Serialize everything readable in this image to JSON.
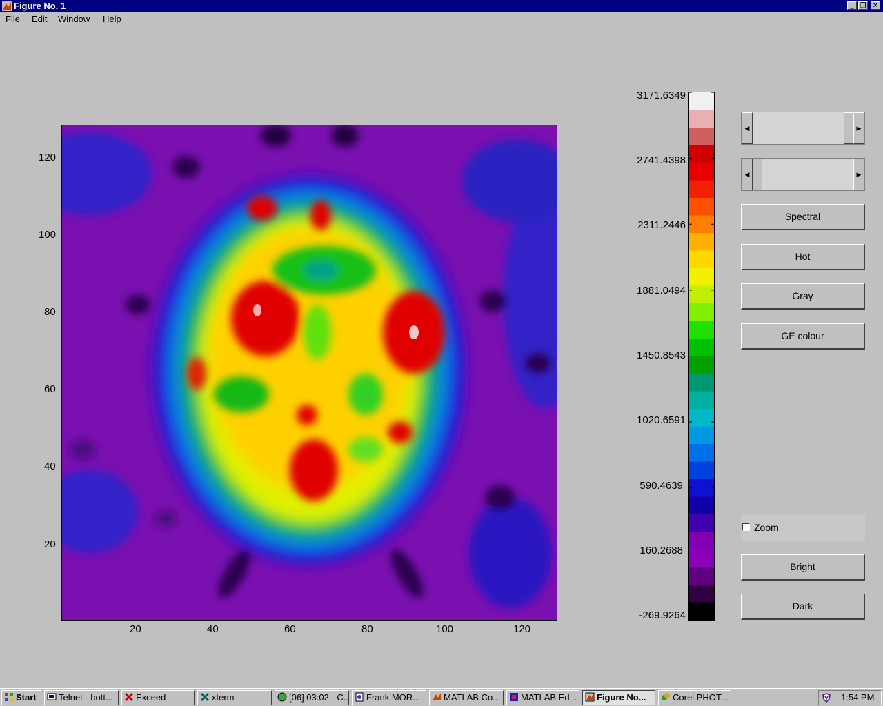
{
  "window": {
    "title": "Figure No. 1"
  },
  "menu": {
    "items": [
      {
        "label": "File"
      },
      {
        "label": "Edit"
      },
      {
        "label": "Window"
      },
      {
        "label": "Help"
      }
    ]
  },
  "image_plot": {
    "x_ticks": [
      "20",
      "40",
      "60",
      "80",
      "100",
      "120"
    ],
    "y_ticks": [
      "120",
      "100",
      "80",
      "60",
      "40",
      "20"
    ]
  },
  "colorbar": {
    "labels": [
      "3171.6349",
      "2741.4398",
      "2311.2446",
      "1881.0494",
      "1450.8543",
      "1020.6591",
      "590.4639",
      "160.2688",
      "-269.9264"
    ]
  },
  "controls": {
    "spectral": "Spectral",
    "hot": "Hot",
    "gray": "Gray",
    "ge_colour": "GE colour",
    "zoom": "Zoom",
    "bright": "Bright",
    "dark": "Dark"
  },
  "taskbar": {
    "start": "Start",
    "tasks": [
      {
        "label": "Telnet - bott..."
      },
      {
        "label": "Exceed"
      },
      {
        "label": "xterm"
      },
      {
        "label": "[06] 03:02 - C..."
      },
      {
        "label": "Frank MOR..."
      },
      {
        "label": "MATLAB Co..."
      },
      {
        "label": "MATLAB Ed..."
      },
      {
        "label": "Figure No..."
      },
      {
        "label": "Corel PHOT..."
      }
    ],
    "clock": "1:54 PM"
  },
  "chart_data": {
    "type": "heatmap",
    "title": "",
    "xlabel": "",
    "ylabel": "",
    "xlim": [
      0.5,
      128.5
    ],
    "ylim": [
      0.5,
      128.5
    ],
    "colormap": "spectral",
    "color_range": [
      -269.9264,
      3171.6349
    ],
    "colorbar_ticks": [
      3171.6349,
      2741.4398,
      2311.2446,
      1881.0494,
      1450.8543,
      1020.6591,
      590.4639,
      160.2688,
      -269.9264
    ]
  }
}
